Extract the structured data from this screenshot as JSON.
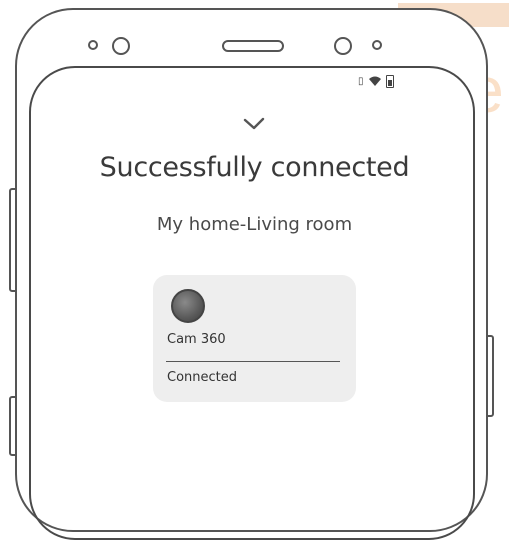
{
  "watermark": {
    "text": "We"
  },
  "screen": {
    "title": "Successfully connected",
    "location": "My home-Living room",
    "device": {
      "name": "Cam 360",
      "status": "Connected"
    }
  },
  "icons": {
    "check": "checkmark-icon",
    "device": "camera-ball-icon",
    "vibrate": "vibrate-icon",
    "wifi": "wifi-icon",
    "battery": "battery-icon"
  }
}
